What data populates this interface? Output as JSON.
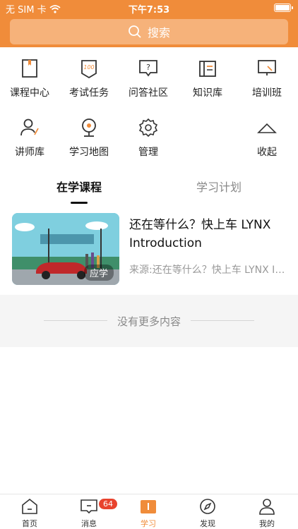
{
  "status_bar": {
    "carrier": "无 SIM 卡",
    "time": "下午7:53"
  },
  "search": {
    "placeholder": "搜索"
  },
  "grid": [
    {
      "label": "课程中心",
      "icon": "book-icon"
    },
    {
      "label": "考试任务",
      "icon": "exam-icon"
    },
    {
      "label": "问答社区",
      "icon": "qa-icon"
    },
    {
      "label": "知识库",
      "icon": "knowledge-icon"
    },
    {
      "label": "培训班",
      "icon": "training-icon"
    },
    {
      "label": "讲师库",
      "icon": "lecturer-icon"
    },
    {
      "label": "学习地图",
      "icon": "map-pin-icon"
    },
    {
      "label": "管理",
      "icon": "gear-icon"
    },
    {
      "label": "收起",
      "icon": "chevron-up-icon"
    }
  ],
  "tabs": [
    {
      "label": "在学课程"
    },
    {
      "label": "学习计划"
    }
  ],
  "course": {
    "title": "还在等什么？快上车 LYNX Introduction",
    "source": "来源:还在等什么？快上车 LYNX Introduction",
    "tag": "应学"
  },
  "list_end": "没有更多内容",
  "tabbar": [
    {
      "label": "首页",
      "icon": "home-icon"
    },
    {
      "label": "消息",
      "icon": "message-icon",
      "badge": "64"
    },
    {
      "label": "学习",
      "icon": "study-icon"
    },
    {
      "label": "发现",
      "icon": "compass-icon"
    },
    {
      "label": "我的",
      "icon": "profile-icon"
    }
  ],
  "colors": {
    "accent": "#f08c3a",
    "badge": "#e8432e"
  }
}
